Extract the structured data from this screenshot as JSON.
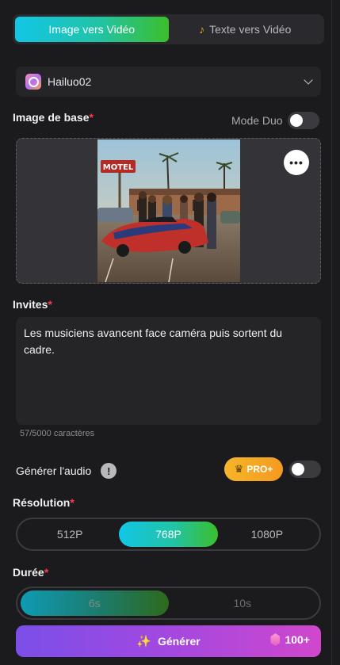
{
  "tabs": [
    {
      "label": "Image vers Vidéo",
      "active": true
    },
    {
      "label": "Texte vers Vidéo",
      "active": false,
      "icon": "music-note-icon"
    }
  ],
  "model": {
    "name": "Hailuo02",
    "icon": "hailuo-logo-icon"
  },
  "image_section": {
    "label": "Image de base",
    "required_mark": "*",
    "duo_label": "Mode Duo",
    "duo_enabled": false,
    "more_glyph": "•••"
  },
  "prompt_section": {
    "label": "Invites",
    "required_mark": "*",
    "value": "Les musiciens avancent face caméra puis sortent du cadre.",
    "counter": "57/5000 caractères"
  },
  "audio": {
    "label": "Générer l'audio",
    "info_glyph": "!",
    "pro_badge": "PRO+",
    "enabled": false
  },
  "resolution": {
    "label": "Résolution",
    "required_mark": "*",
    "options": [
      "512P",
      "768P",
      "1080P"
    ],
    "selected": "768P"
  },
  "duration": {
    "label": "Durée",
    "required_mark": "*",
    "options": [
      "6s",
      "10s"
    ],
    "selected": "6s"
  },
  "generate": {
    "label": "Générer",
    "credits": "100+"
  },
  "colors": {
    "accent_gradient_start": "#12c6e6",
    "accent_gradient_end": "#3bbf2b",
    "generate_gradient_start": "#7a4fe8",
    "generate_gradient_end": "#d047cc",
    "required": "#ff3b4c",
    "pro_badge": "#f5b52a",
    "background": "#1b1b1e"
  }
}
